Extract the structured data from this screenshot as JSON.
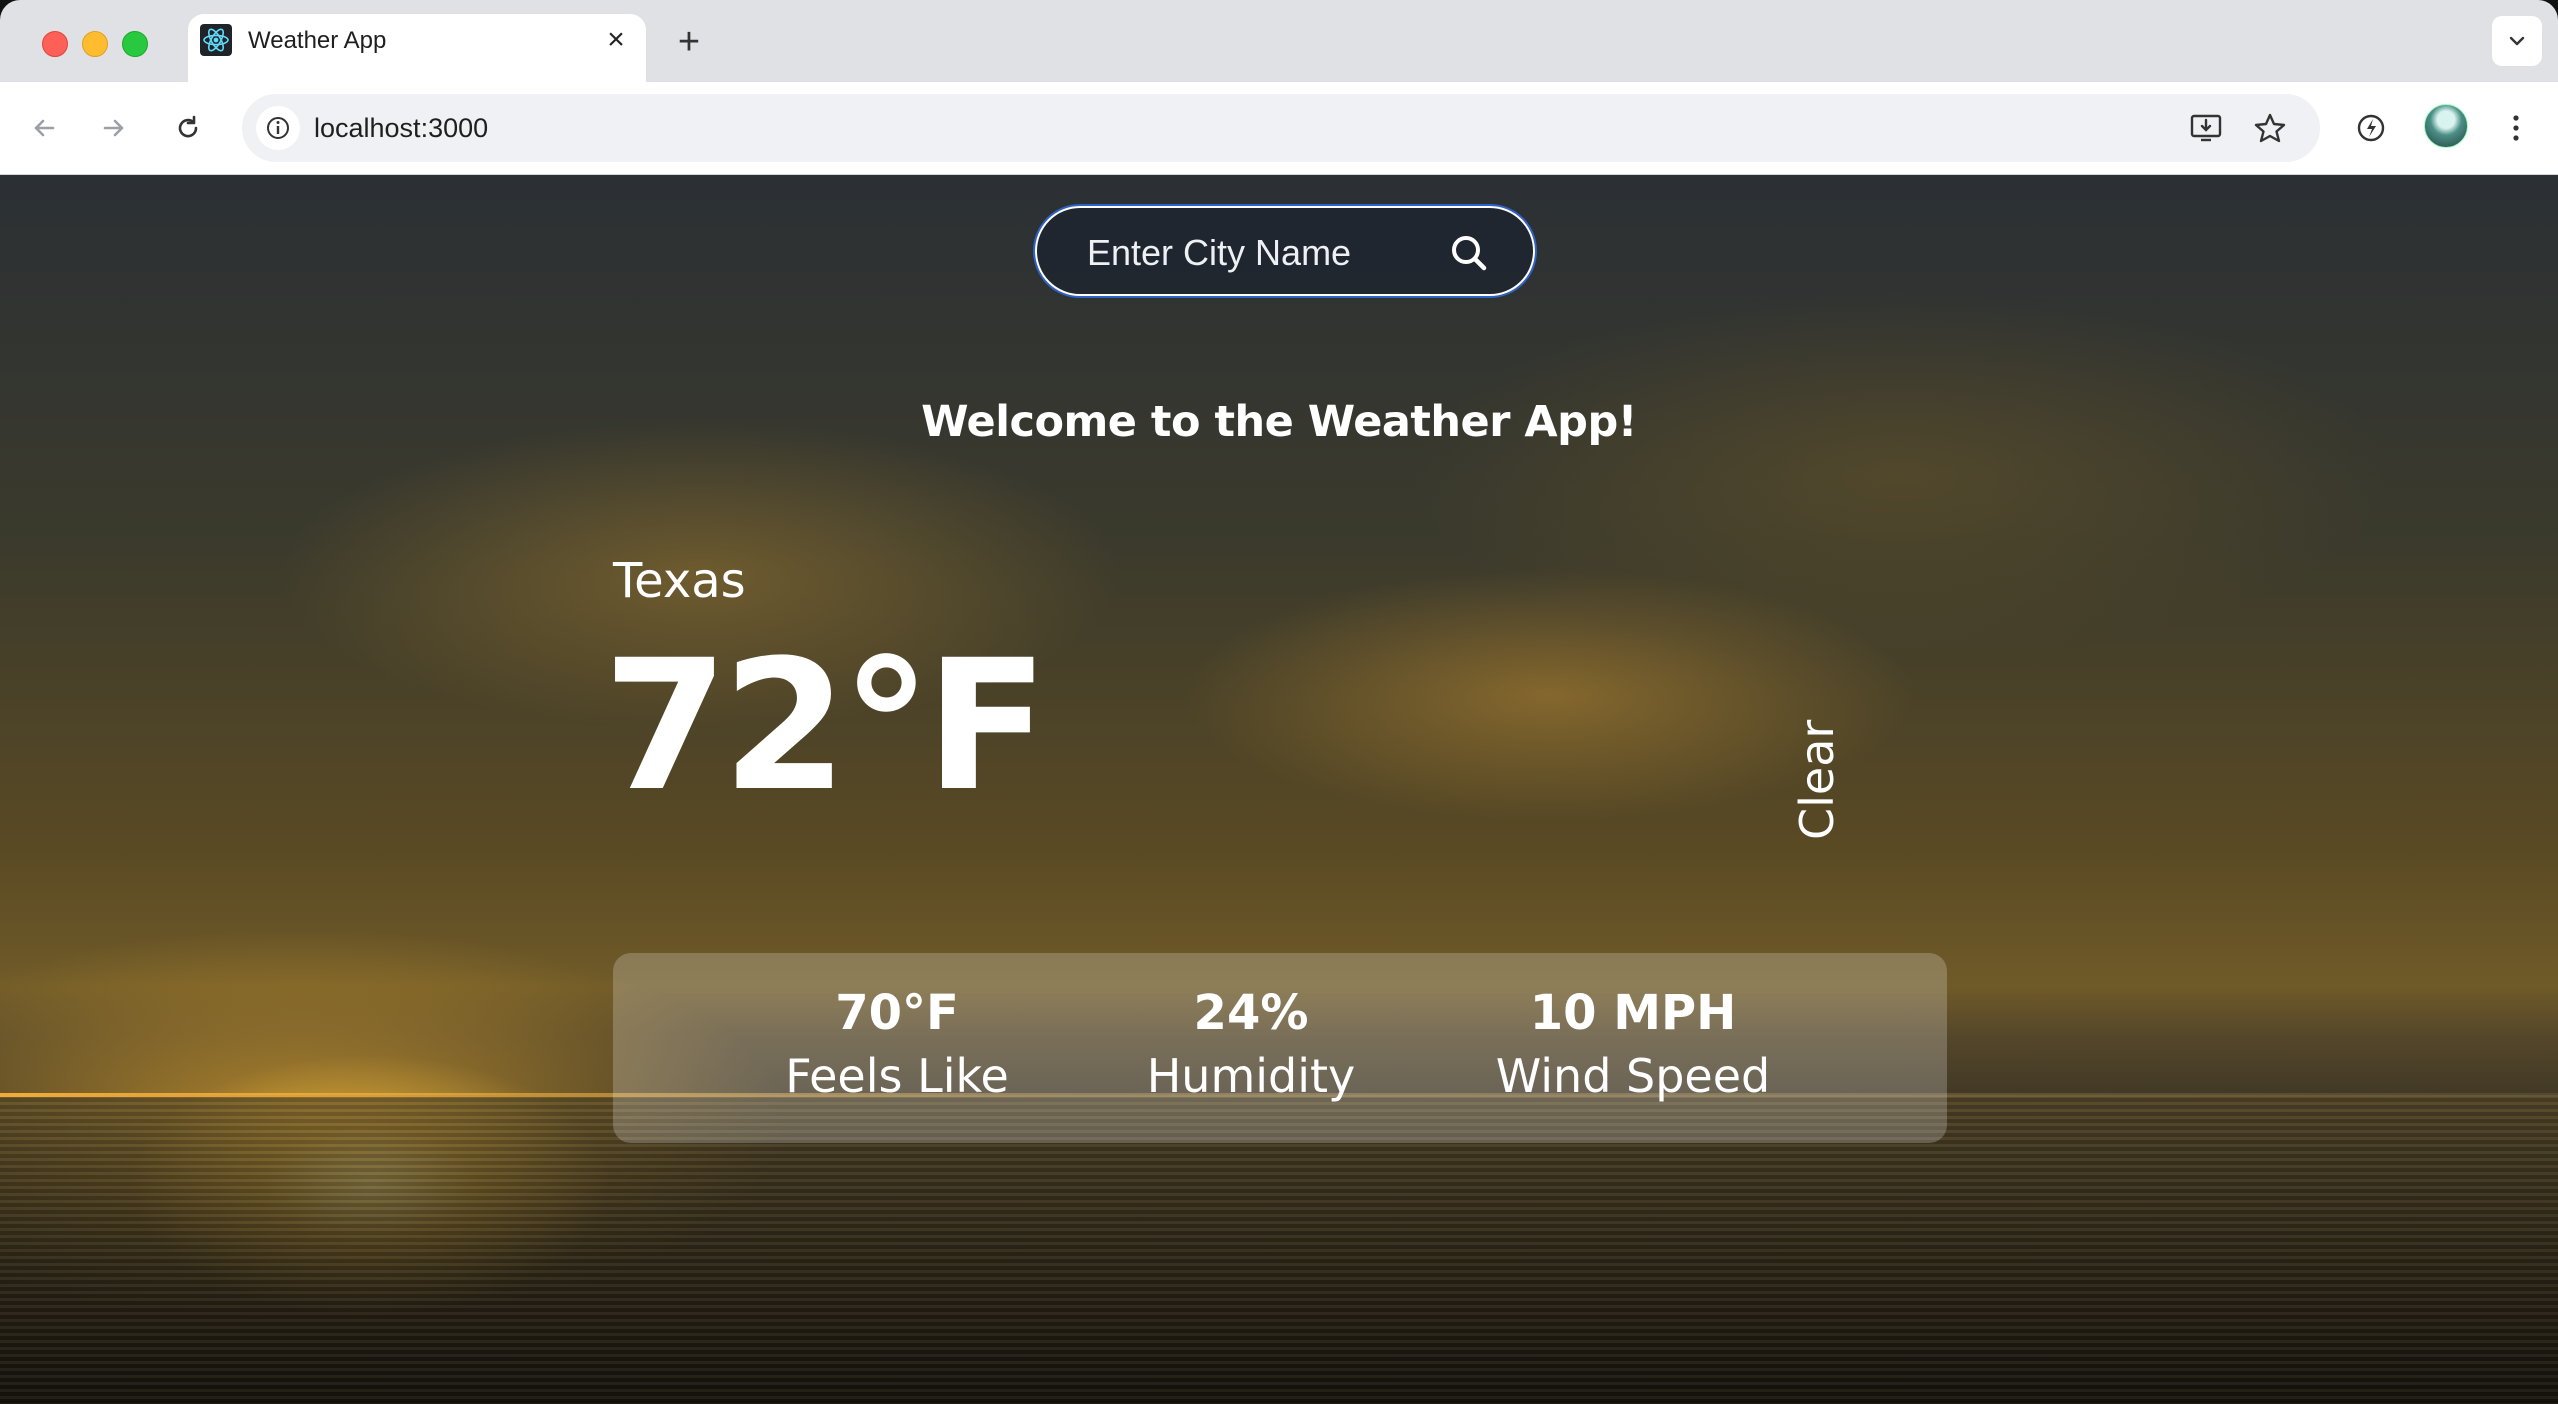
{
  "browser": {
    "tab_title": "Weather App",
    "url": "localhost:3000"
  },
  "search": {
    "placeholder": "Enter City Name"
  },
  "welcome": "Welcome to the Weather App!",
  "weather": {
    "city": "Texas",
    "temperature": "72°F",
    "condition": "Clear",
    "feels_like": {
      "value": "70°F",
      "label": "Feels Like"
    },
    "humidity": {
      "value": "24%",
      "label": "Humidity"
    },
    "wind_speed": {
      "value": "10 MPH",
      "label": "Wind Speed"
    }
  },
  "colors": {
    "search_focus_ring": "#2f62c8",
    "text": "#ffffff"
  }
}
